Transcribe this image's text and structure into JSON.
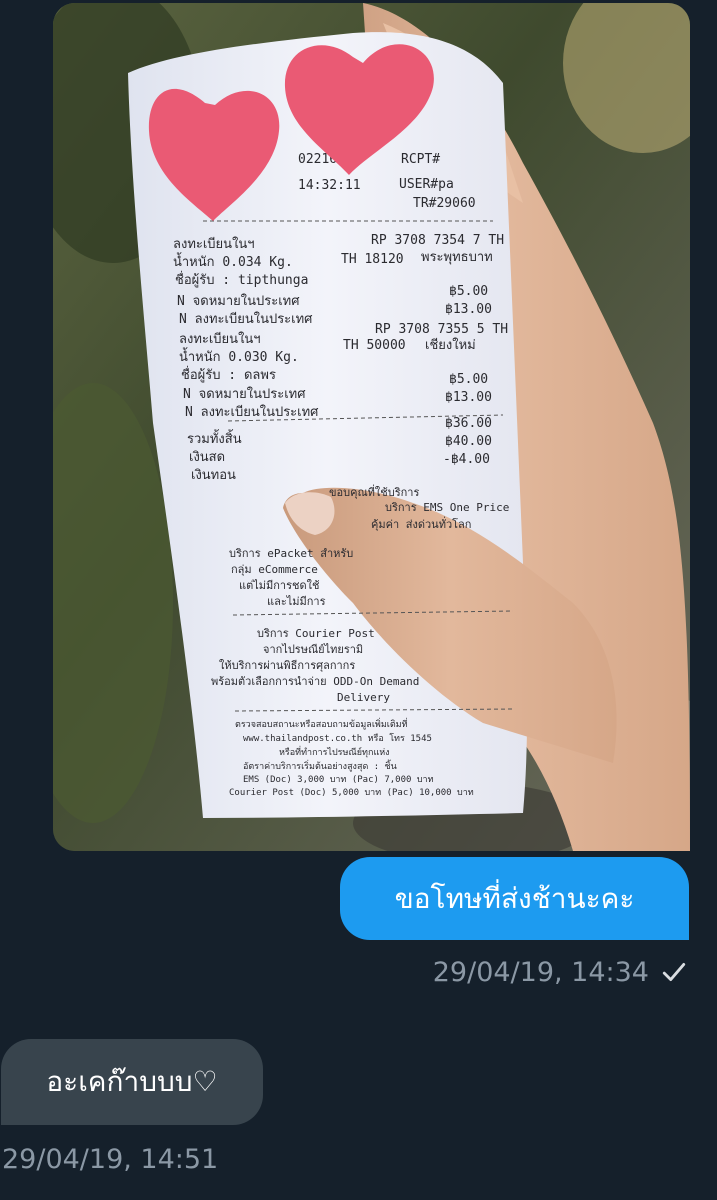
{
  "colors": {
    "background": "#15202b",
    "outgoing_bubble": "#1d9bf0",
    "incoming_bubble": "#38444d",
    "timestamp": "#8b98a5",
    "heart": "#ea5a74"
  },
  "photo": {
    "icons": [
      "heart-sticker",
      "heart-sticker"
    ],
    "receipt": {
      "header_lines": [
        "02216",
        "14:32:11",
        "RCPT#",
        "USER#pa",
        "TR#29060"
      ],
      "item1": {
        "label": "ลงทะเบียนในฯ",
        "tracking": "RP 3708 7354 7 TH",
        "weight": "น้ำหนัก 0.034 Kg.",
        "postcode": "TH 18120",
        "district": "พระพุทธบาท",
        "recipient": "ชื่อผู้รับ : tipthunga",
        "line1": "N จดหมายในประเทศ",
        "price1": "฿5.00",
        "line2": "N ลงทะเบียนในประเทศ",
        "price2": "฿13.00"
      },
      "item2": {
        "label": "ลงทะเบียนในฯ",
        "tracking": "RP 3708 7355 5 TH",
        "weight": "น้ำหนัก 0.030 Kg.",
        "postcode": "TH 50000",
        "district": "เชียงใหม่",
        "recipient": "ชื่อผู้รับ : ดลพร",
        "line1": "N จดหมายในประเทศ",
        "price1": "฿5.00",
        "line2": "N ลงทะเบียนในประเทศ",
        "price2": "฿13.00"
      },
      "totals": {
        "total_label": "รวมทั้งสิ้น",
        "total": "฿36.00",
        "cash_label": "เงินสด",
        "cash": "฿40.00",
        "change_label": "เงินทอน",
        "change": "-฿4.00"
      },
      "footer_lines": [
        "ขอบคุณที่ใช้บริการ",
        "บริการ EMS One Price",
        "คุ้มค่า ส่งด่วนทั่วโลก",
        "บริการ ePacket สำหรับ",
        "กลุ่ม eCommerce",
        "แต่ไม่มีการชดใช้",
        "และไม่มีการ",
        "บริการ Courier Post",
        "จากไปรษณีย์ไทยรามิ",
        "ให้บริการผ่านพิธีการศุลกากร",
        "พร้อมตัวเลือกการนำจ่าย ODD-On Demand",
        "Delivery",
        "ตรวจสอบสถานะหรือสอบถามข้อมูลเพิ่มเติมที่",
        "www.thailandpost.co.th หรือ โทร 1545",
        "หรือที่ทำการไปรษณีย์ทุกแห่ง",
        "อัตราค่าบริการเริ่มต้นอย่างสูงสุด : ชิ้น",
        "EMS (Doc) 3,000 บาท (Pac) 7,000 บาท",
        "Courier Post (Doc) 5,000 บาท (Pac) 10,000 บาท"
      ]
    }
  },
  "messages": {
    "outgoing": {
      "text": "ขอโทษที่ส่งช้านะคะ",
      "timestamp": "29/04/19, 14:34",
      "status_icon": "check-icon"
    },
    "incoming": {
      "text": "อะเคก๊าบบบ♡",
      "timestamp": "29/04/19, 14:51"
    }
  }
}
